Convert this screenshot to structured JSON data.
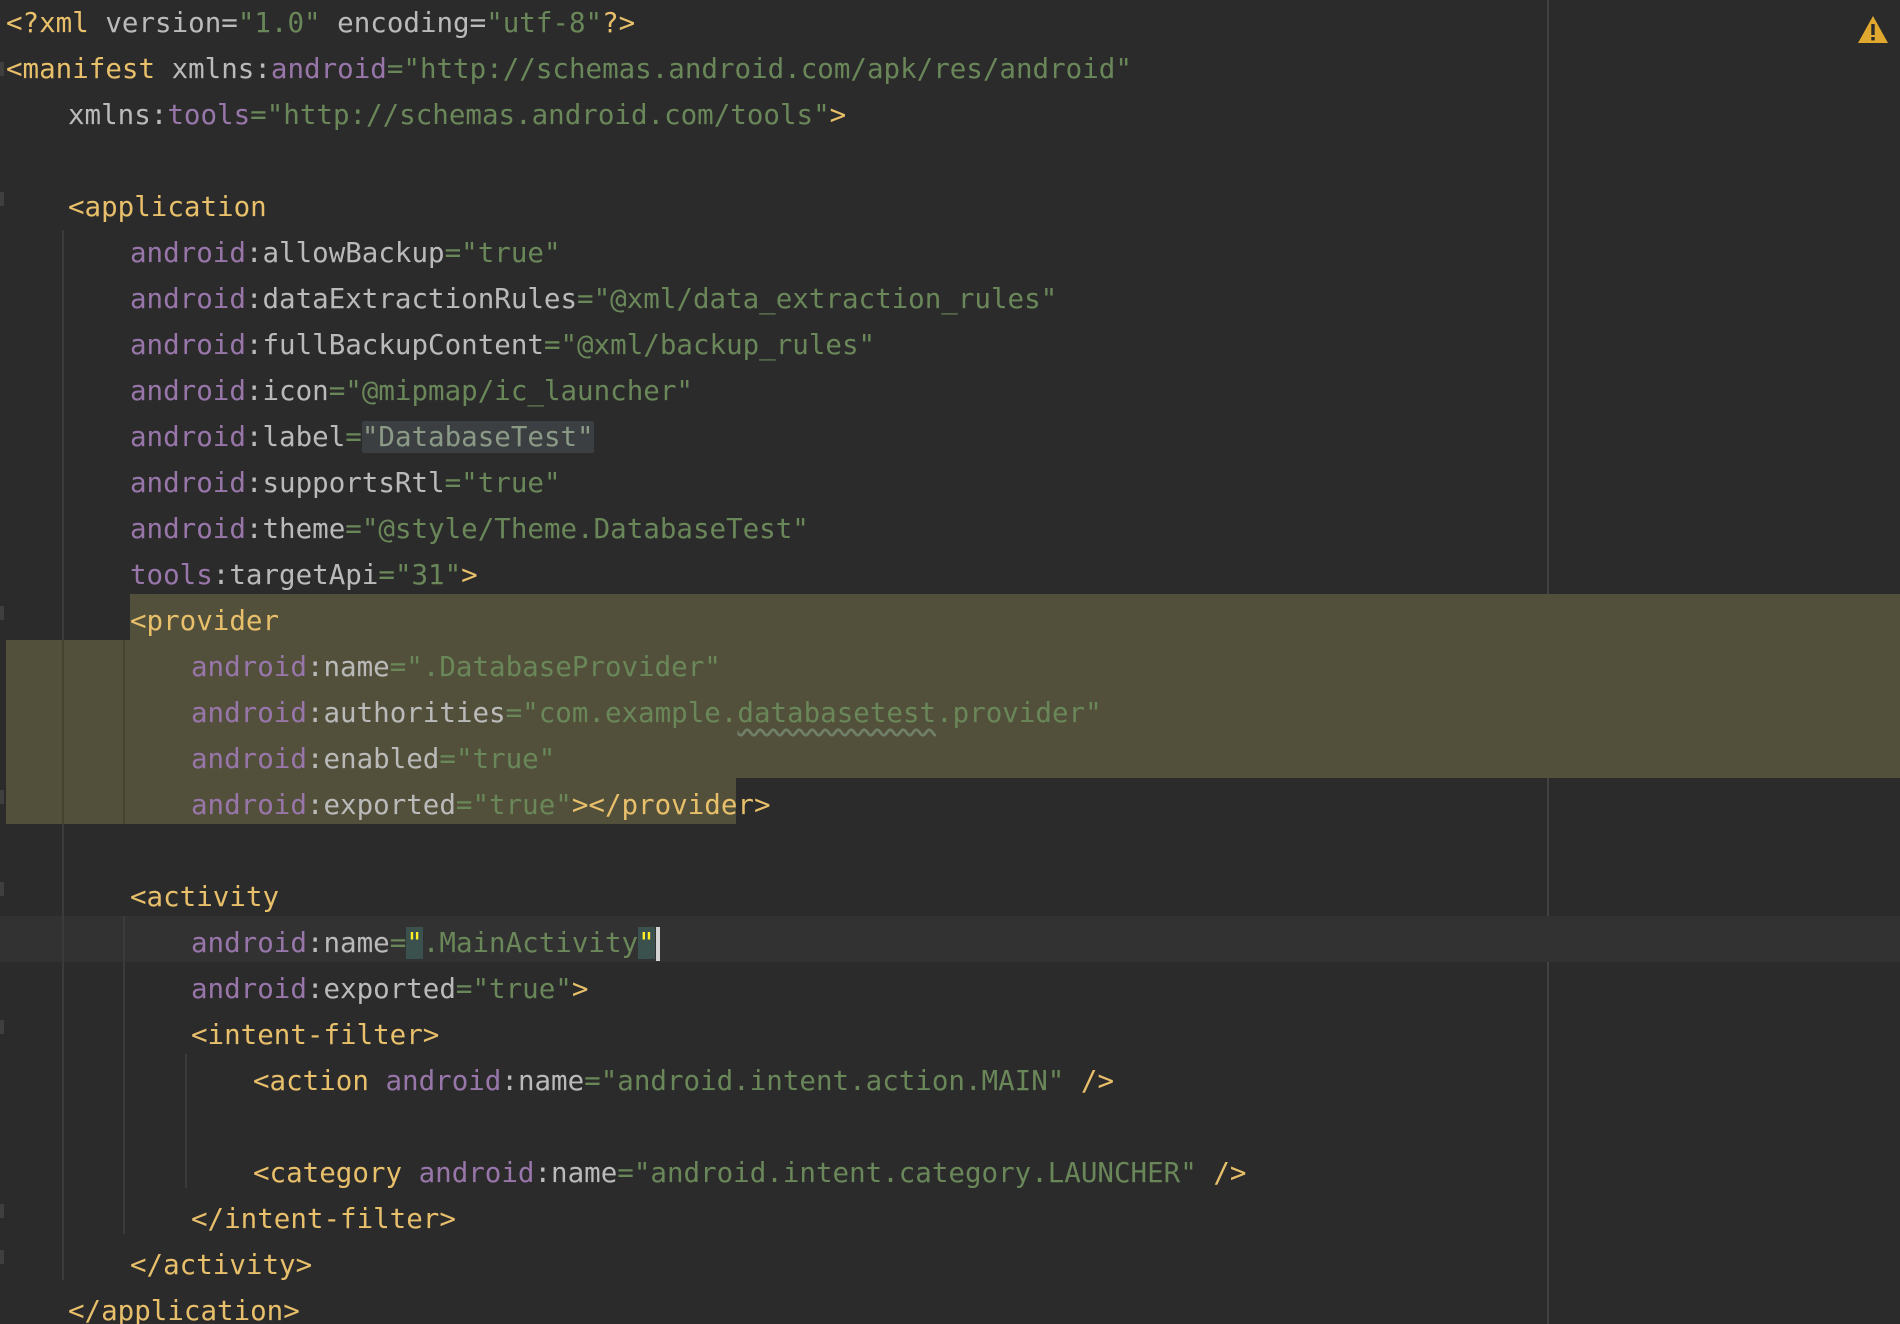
{
  "editor": {
    "warning_icon": "warning-icon",
    "colors": {
      "background": "#2b2b2b",
      "tag": "#e8bf6a",
      "namespace": "#9876aa",
      "attribute": "#bababa",
      "string": "#6a8759",
      "selection": "#52503a",
      "warning": "#e0a82e"
    },
    "lines": {
      "l1": {
        "prolog": "<?xml",
        "version_key": " version=",
        "version_val": "\"1.0\"",
        "enc_key": " encoding=",
        "enc_val": "\"utf-8\"",
        "end": "?>"
      },
      "l2": {
        "tag": "<manifest",
        "xmlns": " xmlns",
        "colon": ":",
        "ns": "android",
        "eq": "=",
        "val": "\"http://schemas.android.com/apk/res/android\""
      },
      "l3": {
        "xmlns": "xmlns",
        "colon": ":",
        "ns": "tools",
        "eq": "=",
        "val": "\"http://schemas.android.com/tools\"",
        "end": ">"
      },
      "l5": {
        "tag": "<application"
      },
      "l6": {
        "ns": "android",
        "colon": ":",
        "attr": "allowBackup",
        "eq": "=",
        "val": "\"true\""
      },
      "l7": {
        "ns": "android",
        "colon": ":",
        "attr": "dataExtractionRules",
        "eq": "=",
        "val": "\"@xml/data_extraction_rules\""
      },
      "l8": {
        "ns": "android",
        "colon": ":",
        "attr": "fullBackupContent",
        "eq": "=",
        "val": "\"@xml/backup_rules\""
      },
      "l9": {
        "ns": "android",
        "colon": ":",
        "attr": "icon",
        "eq": "=",
        "val": "\"@mipmap/ic_launcher\""
      },
      "l10": {
        "ns": "android",
        "colon": ":",
        "attr": "label",
        "eq": "=",
        "val": "\"DatabaseTest\""
      },
      "l11": {
        "ns": "android",
        "colon": ":",
        "attr": "supportsRtl",
        "eq": "=",
        "val": "\"true\""
      },
      "l12": {
        "ns": "android",
        "colon": ":",
        "attr": "theme",
        "eq": "=",
        "val": "\"@style/Theme.DatabaseTest\""
      },
      "l13": {
        "ns": "tools",
        "colon": ":",
        "attr": "targetApi",
        "eq": "=",
        "val": "\"31\"",
        "end": ">"
      },
      "l14": {
        "tag": "<provider"
      },
      "l15": {
        "ns": "android",
        "colon": ":",
        "attr": "name",
        "eq": "=",
        "val": "\".DatabaseProvider\""
      },
      "l16": {
        "ns": "android",
        "colon": ":",
        "attr": "authorities",
        "eq": "=",
        "val_a": "\"com.example.",
        "val_b": "databasetest",
        "val_c": ".provider\""
      },
      "l17": {
        "ns": "android",
        "colon": ":",
        "attr": "enabled",
        "eq": "=",
        "val": "\"true\""
      },
      "l18": {
        "ns": "android",
        "colon": ":",
        "attr": "exported",
        "eq": "=",
        "val": "\"true\"",
        "end": "></provider>"
      },
      "l20": {
        "tag": "<activity"
      },
      "l21": {
        "ns": "android",
        "colon": ":",
        "attr": "name",
        "eq": "=",
        "q1": "\"",
        "val": ".MainActivity",
        "q2": "\""
      },
      "l22": {
        "ns": "android",
        "colon": ":",
        "attr": "exported",
        "eq": "=",
        "val": "\"true\"",
        "end": ">"
      },
      "l23": {
        "tag": "<intent-filter>"
      },
      "l24": {
        "tag": "<action",
        "sp": " ",
        "ns": "android",
        "colon": ":",
        "attr": "name",
        "eq": "=",
        "val": "\"android.intent.action.MAIN\"",
        "end": " />"
      },
      "l26": {
        "tag": "<category",
        "sp": " ",
        "ns": "android",
        "colon": ":",
        "attr": "name",
        "eq": "=",
        "val": "\"android.intent.category.LAUNCHER\"",
        "end": " />"
      },
      "l27": {
        "tag": "</intent-filter>"
      },
      "l28": {
        "tag": "</activity>"
      },
      "l29": {
        "tag": "</application>"
      }
    }
  }
}
